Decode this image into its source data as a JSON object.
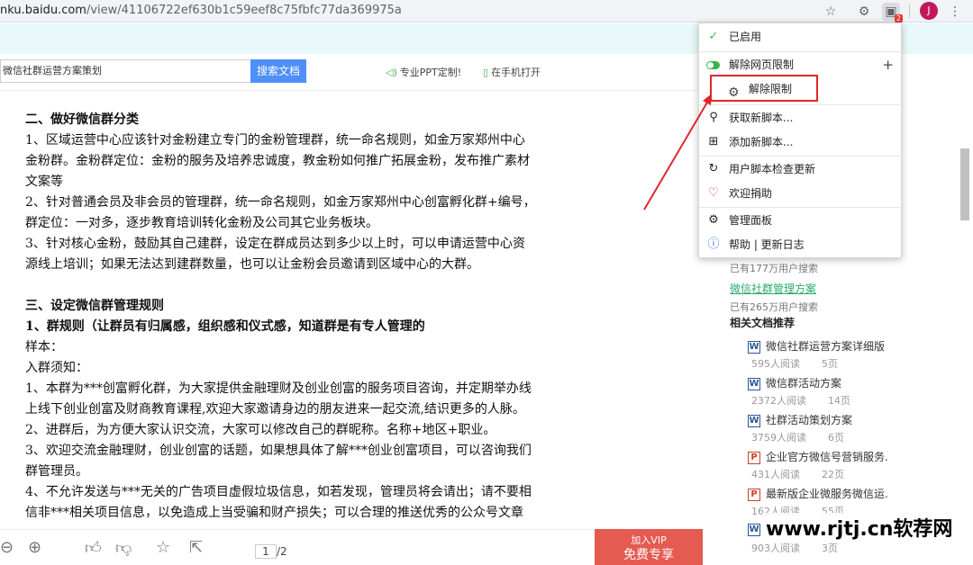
{
  "browser": {
    "url_host": "nku.baidu.com",
    "url_path": "/view/41106722ef630b1c59eef8c75fbfc77da369975a",
    "ext_badge": "2",
    "avatar_letter": "J"
  },
  "search": {
    "value": "微信社群运营方案策划",
    "button": "搜索文档"
  },
  "promos": [
    "专业PPT定制!",
    "在手机打开"
  ],
  "doc_lines": [
    {
      "text": "二、做好微信群分类",
      "style": "h"
    },
    {
      "text": "1、区域运营中心应该针对金粉建立专门的金粉管理群，统一命名规则，如金万家郑州中心",
      "style": ""
    },
    {
      "text": "金粉群。金粉群定位：金粉的服务及培养忠诚度，教金粉如何推广拓展金粉，发布推广素材",
      "style": ""
    },
    {
      "text": "文案等",
      "style": ""
    },
    {
      "text": "2、针对普通会员及非会员的管理群，统一命名规则，如金万家郑州中心创富孵化群+编号，",
      "style": ""
    },
    {
      "text": "群定位：一对多，逐步教育培训转化金粉及公司其它业务板块。",
      "style": ""
    },
    {
      "text": "3、针对核心金粉，鼓励其自己建群，设定在群成员达到多少以上时，可以申请运营中心资",
      "style": ""
    },
    {
      "text": "源线上培训；如果无法达到建群数量，也可以让金粉会员邀请到区域中心的大群。",
      "style": ""
    },
    {
      "text": "",
      "style": "gap"
    },
    {
      "text": "三、设定微信群管理规则",
      "style": "h"
    },
    {
      "text": "1、群规则（让群员有归属感，组织感和仪式感，知道群是有专人管理的",
      "style": "h"
    },
    {
      "text": "样本：",
      "style": ""
    },
    {
      "text": "入群须知：",
      "style": ""
    },
    {
      "text": "1、本群为***创富孵化群，为大家提供金融理财及创业创富的服务项目咨询，并定期举办线",
      "style": ""
    },
    {
      "text": "上线下创业创富及财商教育课程,欢迎大家邀请身边的朋友进来一起交流,结识更多的人脉。",
      "style": ""
    },
    {
      "text": "2、进群后，为方便大家认识交流，大家可以修改自己的群昵称。名称+地区+职业。",
      "style": ""
    },
    {
      "text": "3、欢迎交流金融理财，创业创富的话题，如果想具体了解***创业创富项目，可以咨询我们",
      "style": ""
    },
    {
      "text": "群管理员。",
      "style": ""
    },
    {
      "text": "4、不允许发送与***无关的广告项目虚假垃圾信息，如若发现，管理员将会请出；请不要相",
      "style": ""
    },
    {
      "text": "信非***相关项目信息，以免造成上当受骗和财产损失；可以合理的推送优秀的公众号文章",
      "style": ""
    }
  ],
  "menu": {
    "enabled": "已启用",
    "unlock_limit": "解除网页限制",
    "plus": "+",
    "sub_unlock": "解除限制",
    "get_script": "获取新脚本...",
    "add_script": "添加新脚本...",
    "check_update": "用户脚本检查更新",
    "donate": "欢迎捐助",
    "dashboard": "管理面板",
    "help": "帮助 | 更新日志"
  },
  "sidebar": {
    "searched_1": "已有177万用户搜索",
    "link": "微信社群管理方案",
    "searched_2": "已有265万用户搜索",
    "related_heading": "相关文档推荐",
    "related": [
      {
        "type": "W",
        "title": "微信社群运营方案详细版",
        "reads": "595人阅读",
        "pages": "5页"
      },
      {
        "type": "W",
        "title": "微信群活动方案",
        "reads": "2372人阅读",
        "pages": "14页"
      },
      {
        "type": "W",
        "title": "社群活动策划方案",
        "reads": "3759人阅读",
        "pages": "6页"
      },
      {
        "type": "P",
        "title": "企业官方微信号营销服务.",
        "reads": "431人阅读",
        "pages": "22页"
      },
      {
        "type": "P",
        "title": "最新版企业微服务微信运.",
        "reads": "162人阅读",
        "pages": "55页"
      },
      {
        "type": "W",
        "title": "",
        "reads": "903人阅读",
        "pages": "3页"
      }
    ]
  },
  "bottom": {
    "page_current": "1",
    "page_total": "/2",
    "vip_line1": "加入VIP",
    "vip_line2": "免费专享"
  },
  "watermark": "www.rjtj.cn软荐网",
  "colors": {
    "accent_red": "#e3262b",
    "search_blue": "#4e8ff8",
    "link_green": "#2aab6f",
    "vip_red": "#e55b51"
  }
}
